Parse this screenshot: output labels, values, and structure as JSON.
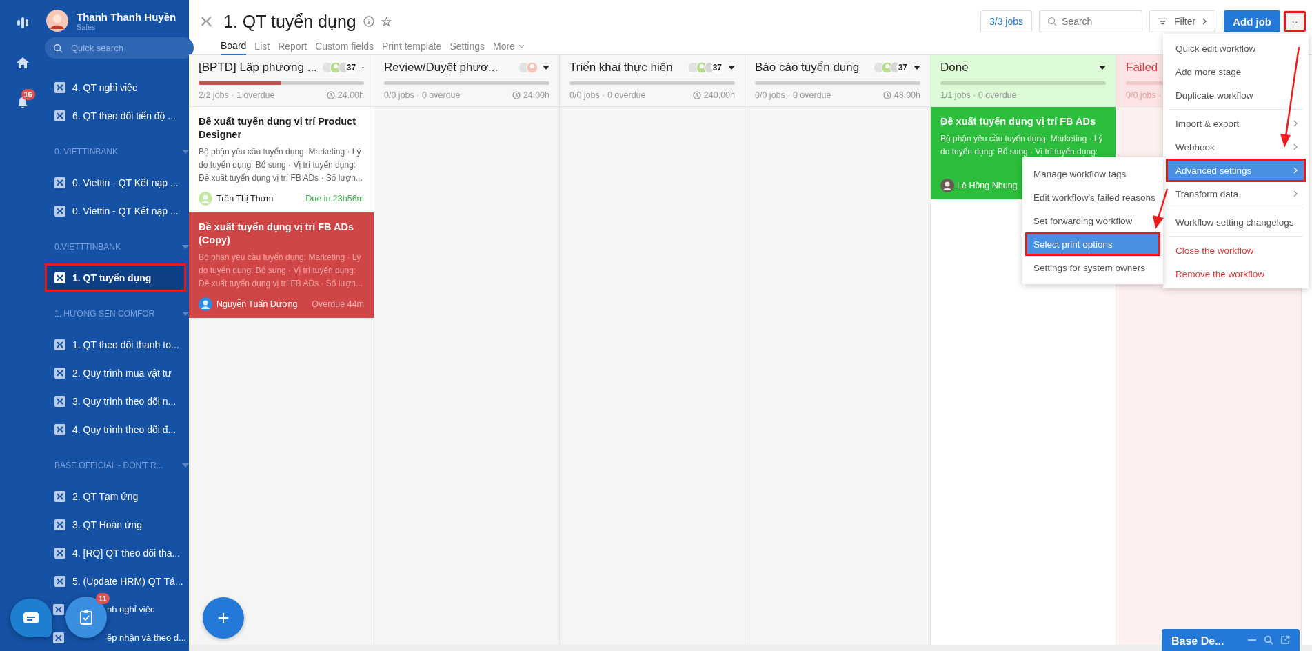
{
  "rail": {
    "notification_badge": "16"
  },
  "user": {
    "name": "Thanh Thanh Huyền",
    "role": "Sales"
  },
  "sidebar_search": {
    "placeholder": "Quick search"
  },
  "sidebar": [
    {
      "items": [
        {
          "label": "4. QT nghỉ việc",
          "selected": false,
          "annotated": false,
          "covered": false
        },
        {
          "label": "6. QT theo dõi tiến độ ...",
          "selected": false,
          "annotated": false,
          "covered": false
        }
      ]
    },
    {
      "heading": "0. VIETTINBANK",
      "items": [
        {
          "label": "0. Viettin - QT Kết nạp ...",
          "selected": false,
          "annotated": false,
          "covered": false
        },
        {
          "label": "0. Viettin - QT Kết nạp ...",
          "selected": false,
          "annotated": false,
          "covered": false
        }
      ]
    },
    {
      "heading": "0.VIETTTINBANK",
      "items": [
        {
          "label": "1. QT tuyển dụng",
          "selected": true,
          "annotated": true,
          "covered": false
        }
      ]
    },
    {
      "heading": "1. HƯƠNG SEN COMFOR",
      "items": [
        {
          "label": "1. QT theo dõi thanh to...",
          "selected": false,
          "annotated": false,
          "covered": false
        },
        {
          "label": "2. Quy trình mua vật tư",
          "selected": false,
          "annotated": false,
          "covered": false
        },
        {
          "label": "3. Quy trình theo dõi n...",
          "selected": false,
          "annotated": false,
          "covered": false
        },
        {
          "label": "4. Quy trình theo dõi đ...",
          "selected": false,
          "annotated": false,
          "covered": false
        }
      ]
    },
    {
      "heading": "BASE OFFICIAL - DON'T R...",
      "items": [
        {
          "label": "2. QT Tạm ứng",
          "selected": false,
          "annotated": false,
          "covered": false
        },
        {
          "label": "3. QT Hoàn ứng",
          "selected": false,
          "annotated": false,
          "covered": false
        },
        {
          "label": "4. [RQ] QT theo dõi tha...",
          "selected": false,
          "annotated": false,
          "covered": false
        },
        {
          "label": "5. (Update HRM) QT Tá...",
          "selected": false,
          "annotated": false,
          "covered": false
        },
        {
          "label": "nh nghỉ việc",
          "selected": false,
          "annotated": false,
          "covered": true
        },
        {
          "label": "ếp nhận và theo d...",
          "selected": false,
          "annotated": false,
          "covered": true
        }
      ]
    }
  ],
  "floating": {
    "task_badge": "11"
  },
  "header": {
    "title": "1. QT tuyển dụng",
    "tabs": [
      {
        "label": "Board",
        "selected": true
      },
      {
        "label": "List",
        "selected": false
      },
      {
        "label": "Report",
        "selected": false
      },
      {
        "label": "Custom fields",
        "selected": false
      },
      {
        "label": "Print template",
        "selected": false
      },
      {
        "label": "Settings",
        "selected": false
      },
      {
        "label": "More",
        "selected": false
      }
    ],
    "jobs_button": "3/3 jobs",
    "search": {
      "placeholder": "Search"
    },
    "filter_button": "Filter",
    "add_button": "Add job",
    "more_button": {
      "label": "··",
      "annotated": true
    }
  },
  "columns": [
    {
      "kind": "normal",
      "title": "[BPTD] Lập phương ...",
      "count": "37",
      "level": 0.5,
      "meta": "2/2 jobs · 1 overdue",
      "time": "24.00h",
      "cards": [
        {
          "kind": "normal",
          "title": "Đề xuất tuyển dụng vị trí Product Designer",
          "description": "Bộ phận yêu cầu tuyển dụng: Marketing · Lý do tuyển dụng: Bổ sung · Vị trí tuyển dụng: Đề xuất tuyển dụng vị trí FB ADs · Số lượn...",
          "assignee": "Trần Thị Thơm",
          "due": "Due in 23h56m"
        },
        {
          "kind": "overdue",
          "title": "Đề xuất tuyển dụng vị trí FB ADs (Copy)",
          "description": "Bộ phận yêu cầu tuyển dụng: Marketing · Lý do tuyển dụng: Bổ sung · Vị trí tuyển dụng: Đề xuất tuyển dụng vị trí FB ADs · Số lượn...",
          "assignee": "Nguyễn Tuấn Dương",
          "due": "Overdue 44m"
        }
      ]
    },
    {
      "kind": "normal",
      "title": "Review/Duyệt phươ...",
      "meta": "0/0 jobs · 0 overdue",
      "time": "24.00h"
    },
    {
      "kind": "normal",
      "title": "Triển khai thực hiện",
      "count": "37",
      "meta": "0/0 jobs · 0 overdue",
      "time": "240.00h"
    },
    {
      "kind": "normal",
      "title": "Báo cáo tuyển dụng",
      "count": "37",
      "meta": "0/0 jobs · 0 overdue",
      "time": "48.00h"
    },
    {
      "kind": "done",
      "title": "Done",
      "meta": "1/1 jobs · 0 overdue",
      "cards": [
        {
          "kind": "done",
          "title": "Đề xuất tuyển dụng vị trí FB ADs",
          "description": "Bộ phận yêu cầu tuyển dụng: Marketing · Lý do tuyển dụng: Bổ sung · Vị trí tuyển dụng:",
          "assignee": "Lê Hồng Nhung"
        }
      ]
    },
    {
      "kind": "failed",
      "title": "Failed",
      "meta": "0/0 jobs ·"
    }
  ],
  "menu": {
    "groups": [
      [
        {
          "label": "Quick edit workflow",
          "submenu": false,
          "selected": false,
          "danger": false,
          "annotated": false
        },
        {
          "label": "Add more stage",
          "submenu": false,
          "selected": false,
          "danger": false,
          "annotated": false
        },
        {
          "label": "Duplicate workflow",
          "submenu": false,
          "selected": false,
          "danger": false,
          "annotated": false
        }
      ],
      [
        {
          "label": "Import & export",
          "submenu": true,
          "selected": false,
          "danger": false,
          "annotated": false
        },
        {
          "label": "Webhook",
          "submenu": true,
          "selected": false,
          "danger": false,
          "annotated": false
        },
        {
          "label": "Advanced settings",
          "submenu": true,
          "selected": true,
          "danger": false,
          "annotated": true
        },
        {
          "label": "Transform data",
          "submenu": true,
          "selected": false,
          "danger": false,
          "annotated": false
        }
      ],
      [
        {
          "label": "Workflow setting changelogs",
          "submenu": false,
          "selected": false,
          "danger": false,
          "annotated": false
        }
      ],
      [
        {
          "label": "Close the workflow",
          "submenu": false,
          "selected": false,
          "danger": true,
          "annotated": false
        },
        {
          "label": "Remove the workflow",
          "submenu": false,
          "selected": false,
          "danger": true,
          "annotated": false
        }
      ]
    ]
  },
  "submenu": {
    "items": [
      {
        "label": "Manage workflow tags",
        "selected": false,
        "annotated": false
      },
      {
        "label": "Edit workflow's failed reasons",
        "selected": false,
        "annotated": false
      },
      {
        "label": "Set forwarding workflow",
        "selected": false,
        "annotated": false
      },
      {
        "label": "Select print options",
        "selected": true,
        "annotated": true
      },
      {
        "label": "Settings for system owners",
        "selected": false,
        "annotated": false
      }
    ]
  },
  "chat_widget": {
    "title": "Base De..."
  }
}
